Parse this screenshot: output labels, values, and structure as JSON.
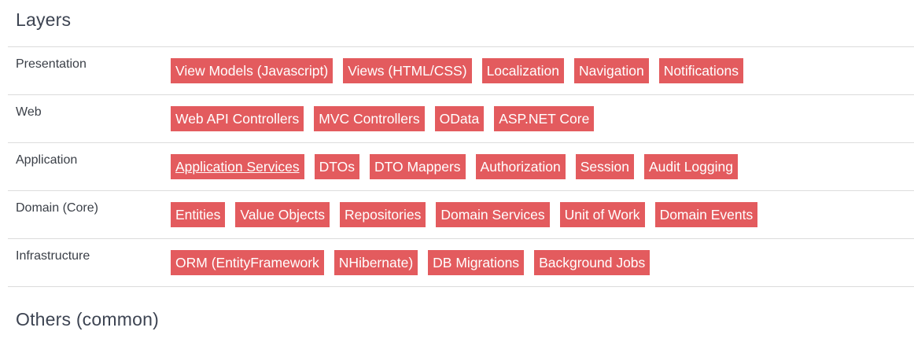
{
  "sections": {
    "layers_title": "Layers",
    "others_title": "Others (common)"
  },
  "colors": {
    "tag_bg": "#e35b5e",
    "tag_text": "#ffffff",
    "divider": "#dcdcdc"
  },
  "rows": [
    {
      "label": "Presentation",
      "tags": [
        "View Models (Javascript)",
        "Views (HTML/CSS)",
        "Localization",
        "Navigation",
        "Notifications"
      ]
    },
    {
      "label": "Web",
      "tags": [
        "Web API Controllers",
        "MVC Controllers",
        "OData",
        "ASP.NET Core"
      ]
    },
    {
      "label": "Application",
      "tags": [
        "Application Services",
        "DTOs",
        "DTO Mappers",
        "Authorization",
        "Session",
        "Audit Logging"
      ]
    },
    {
      "label": "Domain (Core)",
      "tags": [
        "Entities",
        "Value Objects",
        "Repositories",
        "Domain Services",
        "Unit of Work",
        "Domain Events"
      ]
    },
    {
      "label": "Infrastructure",
      "tags": [
        "ORM (EntityFramework",
        "NHibernate)",
        "DB Migrations",
        "Background Jobs"
      ]
    }
  ]
}
